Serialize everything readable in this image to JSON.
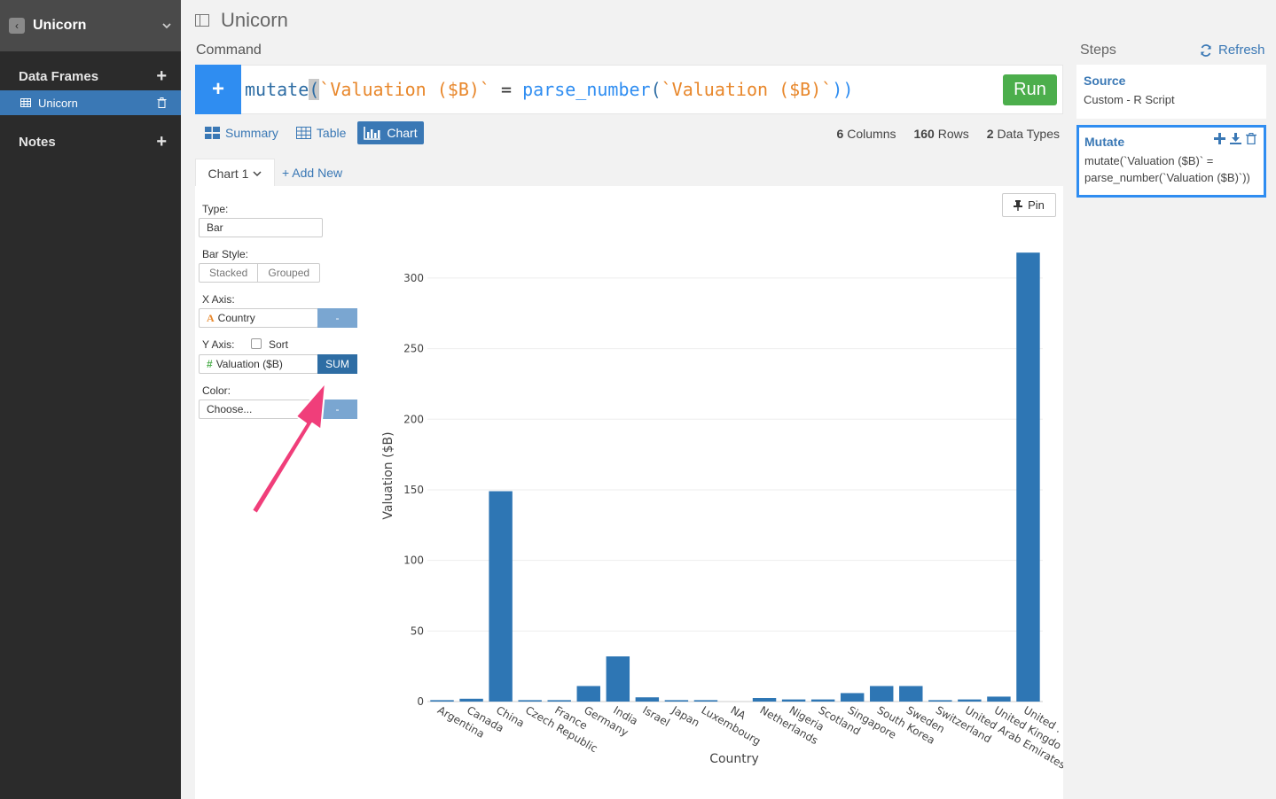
{
  "sidebar": {
    "title": "Unicorn",
    "sections": [
      {
        "label": "Data Frames",
        "items": [
          {
            "label": "Unicorn"
          }
        ]
      },
      {
        "label": "Notes",
        "items": []
      }
    ]
  },
  "header": {
    "title": "Unicorn"
  },
  "command": {
    "label": "Command",
    "tokens": {
      "fn": "mutate",
      "open": "(",
      "str1": "`Valuation ($B)`",
      "eq": " = ",
      "fn2": "parse_number",
      "open2": "(",
      "str2": "`Valuation ($B)`",
      "close": "))"
    },
    "run_label": "Run"
  },
  "tabs": [
    {
      "label": "Summary"
    },
    {
      "label": "Table"
    },
    {
      "label": "Chart",
      "active": true
    }
  ],
  "stats": {
    "columns": "6",
    "columns_label": "Columns",
    "rows": "160",
    "rows_label": "Rows",
    "types": "2",
    "types_label": "Data Types"
  },
  "chart_tab": {
    "label": "Chart 1",
    "add_new": "+ Add New",
    "pin": "Pin"
  },
  "controls": {
    "type_label": "Type:",
    "type_value": "Bar",
    "bar_style_label": "Bar Style:",
    "bar_style_options": [
      "Stacked",
      "Grouped"
    ],
    "x_axis_label": "X Axis:",
    "x_axis_value": "Country",
    "x_axis_btn": "-",
    "y_axis_label": "Y Axis:",
    "sort_label": "Sort",
    "y_axis_value": "Valuation ($B)",
    "y_axis_btn": "SUM",
    "color_label": "Color:",
    "color_value": "Choose...",
    "color_btn": "-"
  },
  "steps": {
    "label": "Steps",
    "refresh": "Refresh",
    "items": [
      {
        "title": "Source",
        "desc": "Custom - R Script"
      },
      {
        "title": "Mutate",
        "desc": "mutate(`Valuation ($B)` = parse_number(`Valuation ($B)`))"
      }
    ]
  },
  "colors": {
    "accent": "#3a78b5",
    "bar": "#2e76b4",
    "run": "#4cae4c",
    "annotation": "#f03e7a"
  },
  "chart_data": {
    "type": "bar",
    "xlabel": "Country",
    "ylabel": "Valuation ($B)",
    "ylim": [
      0,
      320
    ],
    "yticks": [
      0,
      50,
      100,
      150,
      200,
      250,
      300
    ],
    "categories": [
      "Argentina",
      "Canada",
      "China",
      "Czech Republic",
      "France",
      "Germany",
      "India",
      "Israel",
      "Japan",
      "Luxembourg",
      "NA",
      "Netherlands",
      "Nigeria",
      "Scotland",
      "Singapore",
      "South Korea",
      "Sweden",
      "Switzerland",
      "United Arab Emirates",
      "United Kingdom",
      "United States"
    ],
    "tick_labels": [
      "Argentina",
      "Canada",
      "China",
      "Czech Republic",
      "France",
      "Germany",
      "India",
      "Israel",
      "Japan",
      "Luxembourg",
      "NA",
      "Netherlands",
      "Nigeria",
      "Scotland",
      "Singapore",
      "South Korea",
      "Sweden",
      "Switzerland",
      "United Arab Emirates",
      "United Kingdo",
      "United ."
    ],
    "values": [
      1,
      2,
      149,
      1,
      1,
      11,
      32,
      3,
      1,
      1,
      0,
      2.5,
      1.5,
      1.5,
      6,
      11,
      11,
      1,
      1.5,
      3.5,
      318
    ],
    "grid": true
  }
}
